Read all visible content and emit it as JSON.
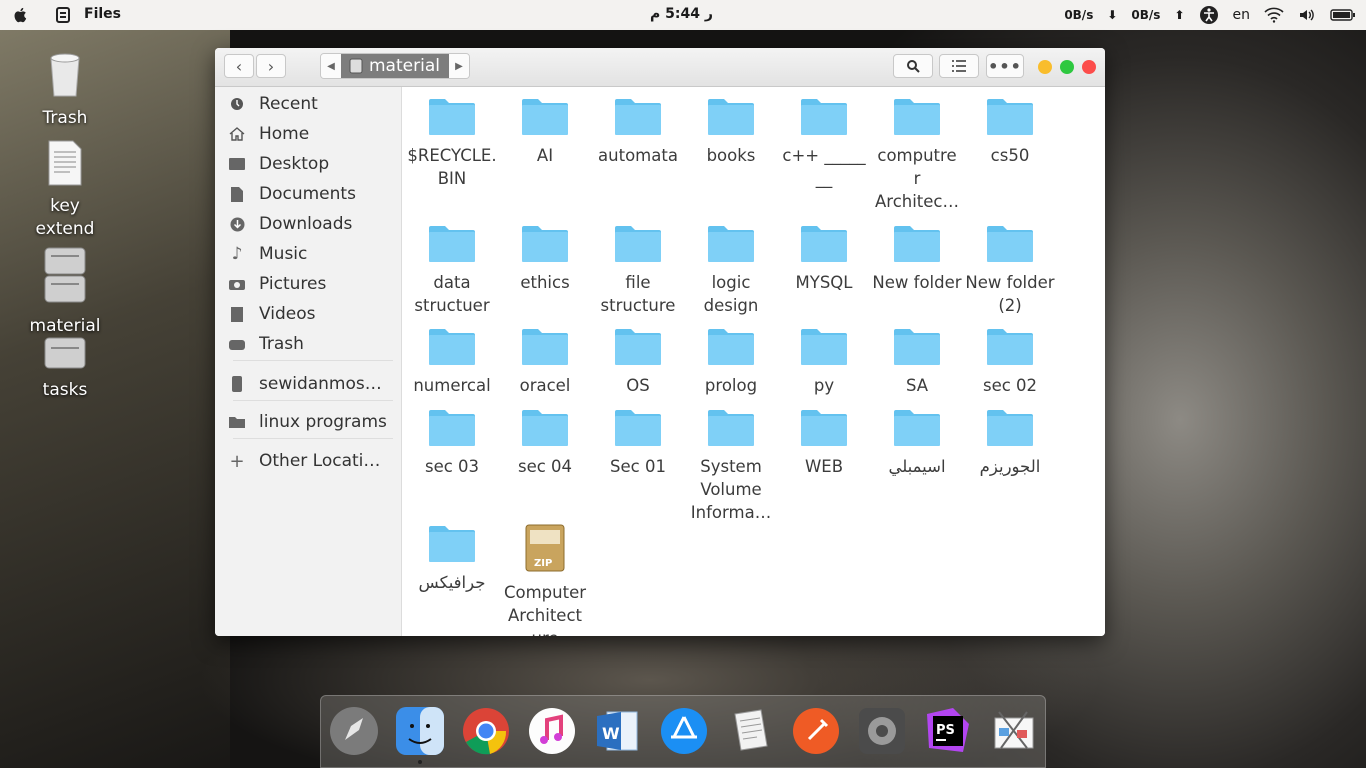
{
  "topbar": {
    "app_name": "Files",
    "clock": "ر 5:44 م",
    "net_down": "0B/s",
    "net_up": "0B/s",
    "language": "en"
  },
  "desktop": {
    "items": [
      {
        "label": "Trash"
      },
      {
        "label": "key extend linux"
      },
      {
        "label": "material"
      },
      {
        "label": "tasks"
      }
    ]
  },
  "window": {
    "breadcrumb": "material",
    "sidebar": [
      {
        "label": "Recent",
        "icon": "clock-icon"
      },
      {
        "label": "Home",
        "icon": "home-icon"
      },
      {
        "label": "Desktop",
        "icon": "desktop-icon"
      },
      {
        "label": "Documents",
        "icon": "document-icon"
      },
      {
        "label": "Downloads",
        "icon": "download-icon"
      },
      {
        "label": "Music",
        "icon": "music-icon"
      },
      {
        "label": "Pictures",
        "icon": "camera-icon"
      },
      {
        "label": "Videos",
        "icon": "film-icon"
      },
      {
        "label": "Trash",
        "icon": "trash-icon"
      },
      {
        "label": "sewidanmost…",
        "icon": "drive-icon"
      },
      {
        "label": "linux programs",
        "icon": "folder-icon"
      },
      {
        "label": "Other Locations",
        "icon": "plus-icon"
      }
    ],
    "files": [
      {
        "name": "$RECYCLE.BIN",
        "type": "folder"
      },
      {
        "name": "AI",
        "type": "folder"
      },
      {
        "name": "automata",
        "type": "folder"
      },
      {
        "name": "books",
        "type": "folder"
      },
      {
        "name": "c++ _____ __",
        "type": "folder"
      },
      {
        "name": "computre r Architec…",
        "type": "folder"
      },
      {
        "name": "cs50",
        "type": "folder"
      },
      {
        "name": "data structuer",
        "type": "folder"
      },
      {
        "name": "ethics",
        "type": "folder"
      },
      {
        "name": "file structure",
        "type": "folder"
      },
      {
        "name": "logic design",
        "type": "folder"
      },
      {
        "name": "MYSQL",
        "type": "folder"
      },
      {
        "name": "New folder",
        "type": "folder"
      },
      {
        "name": "New folder (2)",
        "type": "folder"
      },
      {
        "name": "numercal",
        "type": "folder"
      },
      {
        "name": "oracel",
        "type": "folder"
      },
      {
        "name": "OS",
        "type": "folder"
      },
      {
        "name": "prolog",
        "type": "folder"
      },
      {
        "name": "py",
        "type": "folder"
      },
      {
        "name": "SA",
        "type": "folder"
      },
      {
        "name": "sec 02",
        "type": "folder"
      },
      {
        "name": "sec 03",
        "type": "folder"
      },
      {
        "name": "sec 04",
        "type": "folder"
      },
      {
        "name": "Sec 01",
        "type": "folder"
      },
      {
        "name": "System Volume Informa…",
        "type": "folder"
      },
      {
        "name": "WEB",
        "type": "folder"
      },
      {
        "name": "اسيمبلي",
        "type": "folder"
      },
      {
        "name": "الجوريزم",
        "type": "folder"
      },
      {
        "name": "جرافيكس",
        "type": "folder"
      },
      {
        "name": "Computer Architect ure",
        "type": "zip",
        "badge": "ZIP"
      }
    ]
  },
  "dock": {
    "items": [
      "launchpad-icon",
      "finder-icon",
      "chrome-icon",
      "music-app-icon",
      "word-icon",
      "app-store-icon",
      "text-editor-icon",
      "postman-icon",
      "settings-icon",
      "phpstorm-icon",
      "screenshot-tool-icon"
    ],
    "phpstorm_label": "PS"
  },
  "colors": {
    "folder": "#7fd0f7",
    "folder_tab": "#63c2ef",
    "close": "#fc4d4b",
    "minimize": "#f9bd2c",
    "maximize": "#2ec840"
  }
}
